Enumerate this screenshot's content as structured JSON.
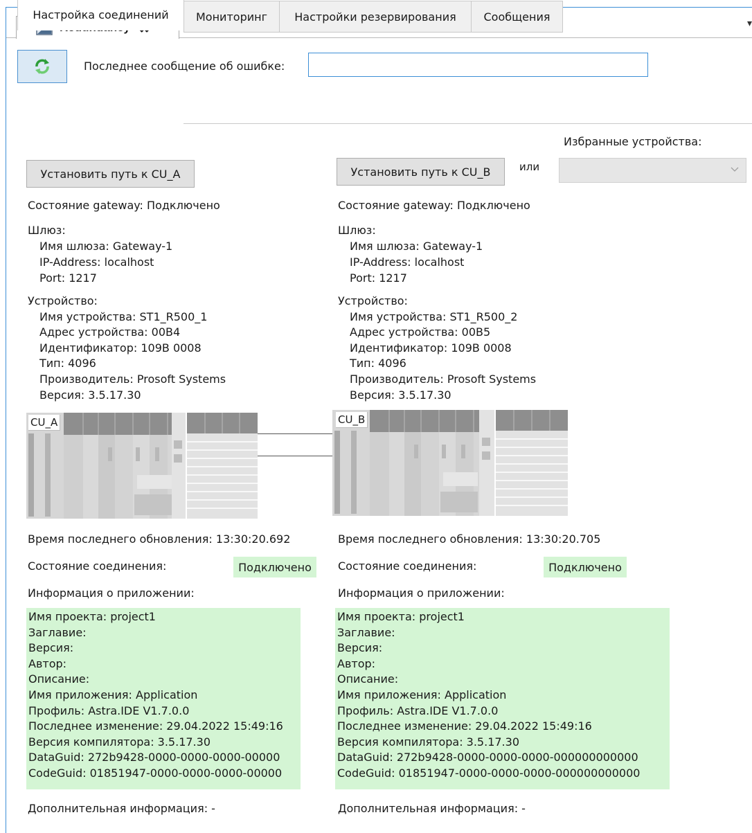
{
  "window": {
    "tab_title": "Redundancy",
    "close_glyph": "✖",
    "chevron": "▾"
  },
  "toolbar": {
    "refresh_icon": "refresh-icon",
    "error_label": "Последнее сообщение об ошибке:",
    "error_value": ""
  },
  "tabs": [
    {
      "label": "Настройка соединений",
      "active": true
    },
    {
      "label": "Мониторинг",
      "active": false
    },
    {
      "label": "Настройки резервирования",
      "active": false
    },
    {
      "label": "Сообщения",
      "active": false
    }
  ],
  "favorites": {
    "label": "Избранные устройства:",
    "or_label": "или",
    "selected": ""
  },
  "cu_a": {
    "set_path_button": "Установить путь к CU_A",
    "gateway_state": "Состояние gateway:   Подключено",
    "gateway_header": "Шлюз:",
    "gateway_name": "Имя шлюза: Gateway-1",
    "ip_address": "IP-Address: localhost",
    "port": "Port: 1217",
    "device_header": "Устройство:",
    "device_name": "Имя устройства: ST1_R500_1",
    "device_address": "Адрес устройства: 00B4",
    "identifier": "Идентификатор:  109B  0008",
    "type": "Тип:  4096",
    "vendor": "Производитель: Prosoft Systems",
    "version": "Версия:  3.5.17.30",
    "plc_label": "CU_A",
    "last_update": "Время последнего обновления:   13:30:20.692",
    "connection_state_label": "Состояние соединения:",
    "connection_state": "Подключено",
    "app_info_label": "Информация о приложении:",
    "app_info": [
      "Имя проекта: project1",
      "Заглавие:",
      "Версия:",
      "Автор:",
      "Описание:",
      "Имя приложения: Application",
      "Профиль: Astra.IDE V1.7.0.0",
      "Последнее изменение:  29.04.2022  15:49:16",
      "Версия компилятора: 3.5.17.30",
      "DataGuid:  272b9428-0000-0000-0000-00000",
      "CodeGuid:  01851947-0000-0000-0000-00000"
    ],
    "extra_info": "Дополнительная информация:   -"
  },
  "cu_b": {
    "set_path_button": "Установить путь к CU_B",
    "gateway_state": "Состояние gateway:   Подключено",
    "gateway_header": "Шлюз:",
    "gateway_name": "Имя шлюза: Gateway-1",
    "ip_address": "IP-Address: localhost",
    "port": "Port: 1217",
    "device_header": "Устройство:",
    "device_name": "Имя устройства: ST1_R500_2",
    "device_address": "Адрес устройства: 00B5",
    "identifier": "Идентификатор:  109B  0008",
    "type": "Тип:  4096",
    "vendor": "Производитель: Prosoft Systems",
    "version": "Версия:  3.5.17.30",
    "plc_label": "CU_B",
    "last_update": "Время последнего обновления:   13:30:20.705",
    "connection_state_label": "Состояние соединения:",
    "connection_state": "Подключено",
    "app_info_label": "Информация о приложении:",
    "app_info": [
      "Имя проекта: project1",
      "Заглавие:",
      "Версия:",
      "Автор:",
      "Описание:",
      "Имя приложения: Application",
      "Профиль: Astra.IDE V1.7.0.0",
      "Последнее изменение:  29.04.2022  15:49:16",
      "Версия компилятора: 3.5.17.30",
      "DataGuid:  272b9428-0000-0000-0000-000000000000",
      "CodeGuid:  01851947-0000-0000-0000-000000000000"
    ],
    "extra_info": "Дополнительная информация:   -"
  },
  "colors": {
    "accent_border": "#3c8fd6",
    "status_bg": "#d4f5d4",
    "button_bg": "#e1e1e1"
  }
}
